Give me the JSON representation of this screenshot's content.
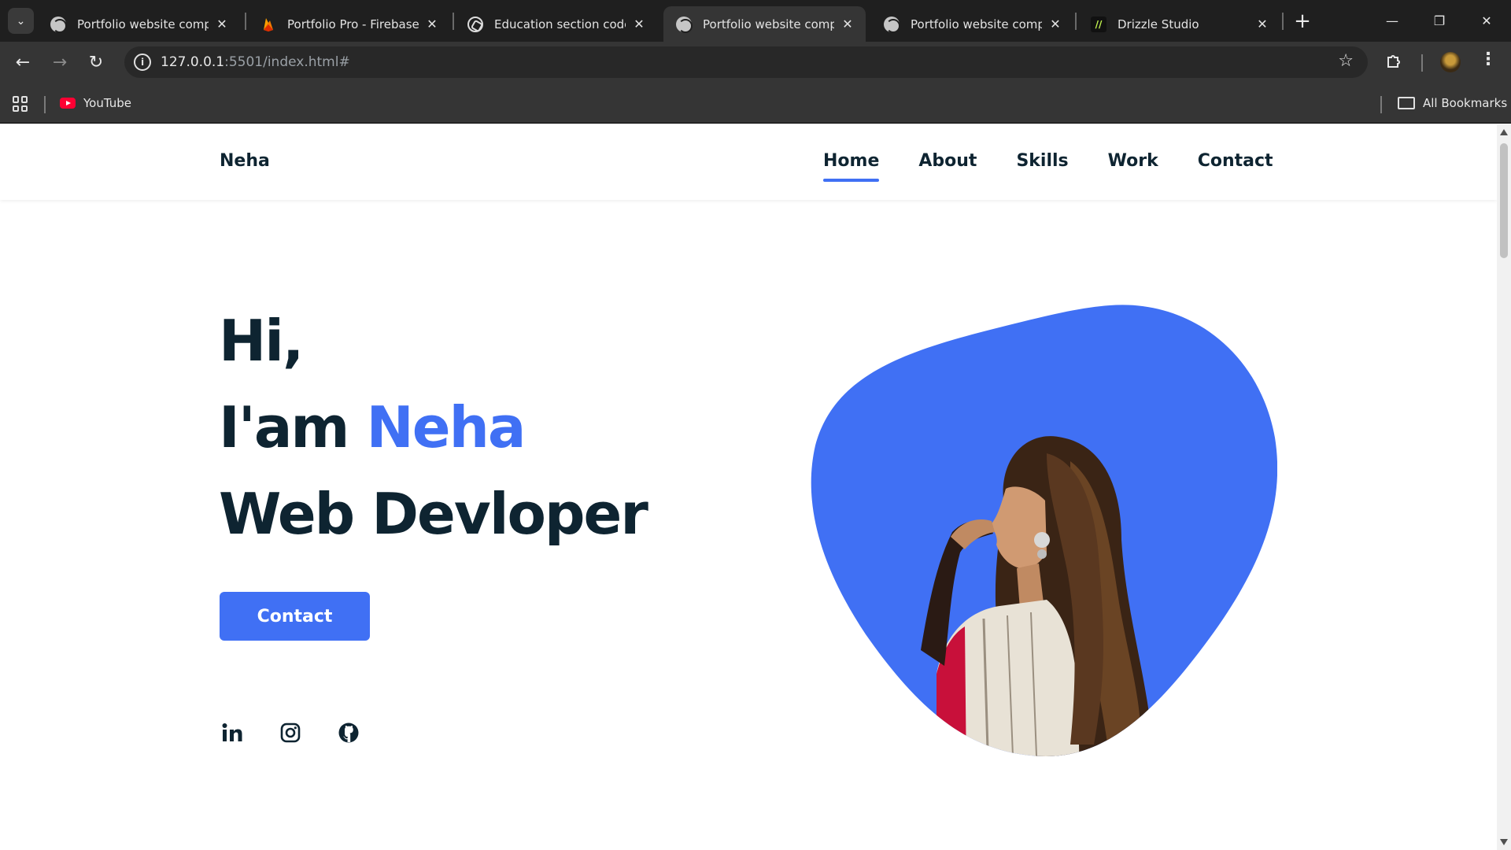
{
  "browser": {
    "tabs": [
      {
        "title": "Portfolio website complete",
        "icon": "globe-icon",
        "active": false
      },
      {
        "title": "Portfolio Pro - Firebase Stu",
        "icon": "firebase-icon",
        "active": false
      },
      {
        "title": "Education section code",
        "icon": "chatgpt-icon",
        "active": false
      },
      {
        "title": "Portfolio website complete",
        "icon": "globe-icon",
        "active": true
      },
      {
        "title": "Portfolio website complete",
        "icon": "globe-icon",
        "active": false
      },
      {
        "title": "Drizzle Studio",
        "icon": "drizzle-icon",
        "active": false
      }
    ],
    "url_host": "127.0.0.1",
    "url_rest": ":5501/index.html#",
    "bookmarks": [
      {
        "label": "YouTube",
        "icon": "youtube-icon"
      }
    ],
    "all_bookmarks_label": "All Bookmarks"
  },
  "site": {
    "logo": "Neha",
    "nav": [
      {
        "label": "Home",
        "active": true
      },
      {
        "label": "About",
        "active": false
      },
      {
        "label": "Skills",
        "active": false
      },
      {
        "label": "Work",
        "active": false
      },
      {
        "label": "Contact",
        "active": false
      }
    ],
    "hero": {
      "line1": "Hi,",
      "line2_prefix": "I'am ",
      "line2_name": "Neha",
      "line3": "Web Devloper",
      "cta_label": "Contact"
    },
    "socials": [
      {
        "icon": "linkedin-icon"
      },
      {
        "icon": "instagram-icon"
      },
      {
        "icon": "github-icon"
      }
    ],
    "colors": {
      "accent": "#4070f4",
      "text": "#0e2431"
    }
  }
}
